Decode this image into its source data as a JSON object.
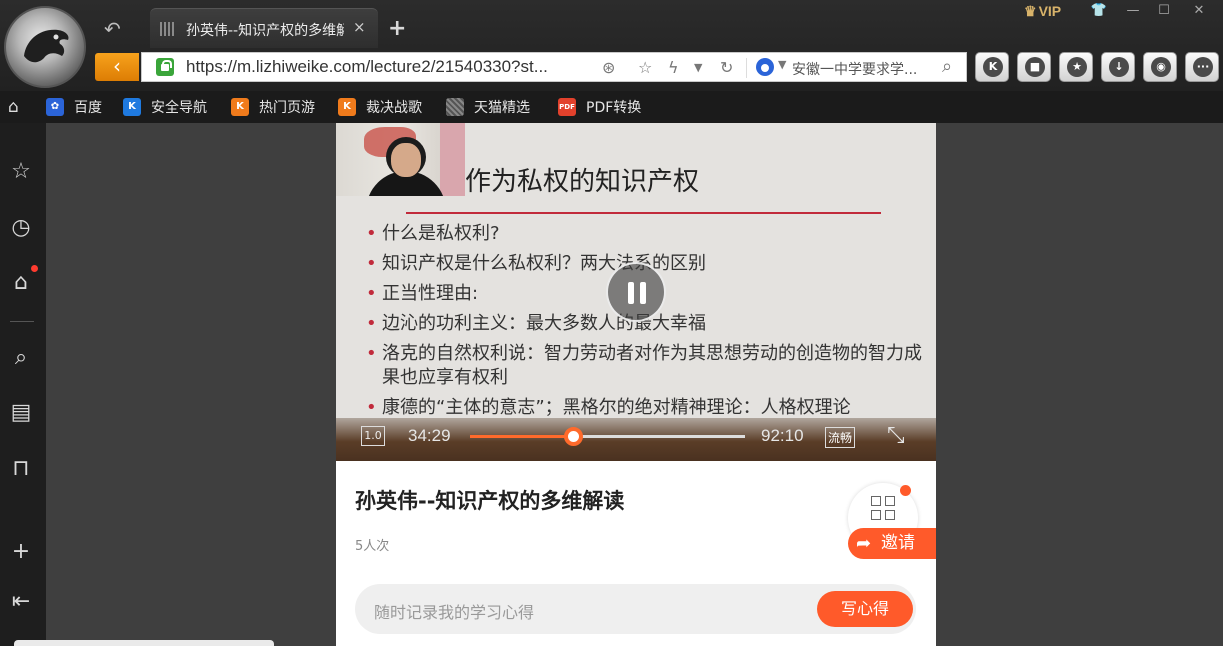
{
  "browser": {
    "tab": {
      "title": "孙英伟--知识产权的多维解读",
      "close": "×"
    },
    "new_tab": "+",
    "vip_label": "VIP",
    "url": "https://m.lizhiweike.com/lecture2/21540330?st...",
    "search_text": "安徽一中学要求学...",
    "toolbar_k": "K"
  },
  "bookmarks": [
    {
      "label": "百度",
      "icon": "baidu-paw-icon",
      "color": "#2b64d8"
    },
    {
      "label": "安全导航",
      "icon": "k-shield-icon",
      "color": "#1f7ae0"
    },
    {
      "label": "热门页游",
      "icon": "k-game-icon",
      "color": "#f07b1c"
    },
    {
      "label": "裁决战歌",
      "icon": "k-game-icon",
      "color": "#f07b1c"
    },
    {
      "label": "天猫精选",
      "icon": "tmall-icon",
      "color": "#8a8a8a"
    },
    {
      "label": "PDF转换",
      "icon": "pdf-icon",
      "color": "#e2412c"
    }
  ],
  "video": {
    "slide_title": "作为私权的知识产权",
    "slide_points": [
      "什么是私权利?",
      "知识产权是什么私权利？两大法系的区别",
      "正当性理由:",
      "边沁的功利主义：最大多数人的最大幸福",
      "洛克的自然权利说：智力劳动者对作为其思想劳动的创造物的智力成果也应享有权利",
      "康德的“主体的意志”；黑格尔的绝对精神理论：人格权理论"
    ],
    "speed": "1.0",
    "current_time": "34:29",
    "total_time": "92:10",
    "progress_fraction": 0.374,
    "quality": "流畅"
  },
  "lecture": {
    "title": "孙英伟--知识产权的多维解读",
    "views": "5人次",
    "invite_label": "邀请",
    "note_placeholder": "随时记录我的学习心得",
    "note_button": "写心得"
  },
  "colors": {
    "accent": "#ff5a2a",
    "slide_red": "#c12a3b"
  }
}
